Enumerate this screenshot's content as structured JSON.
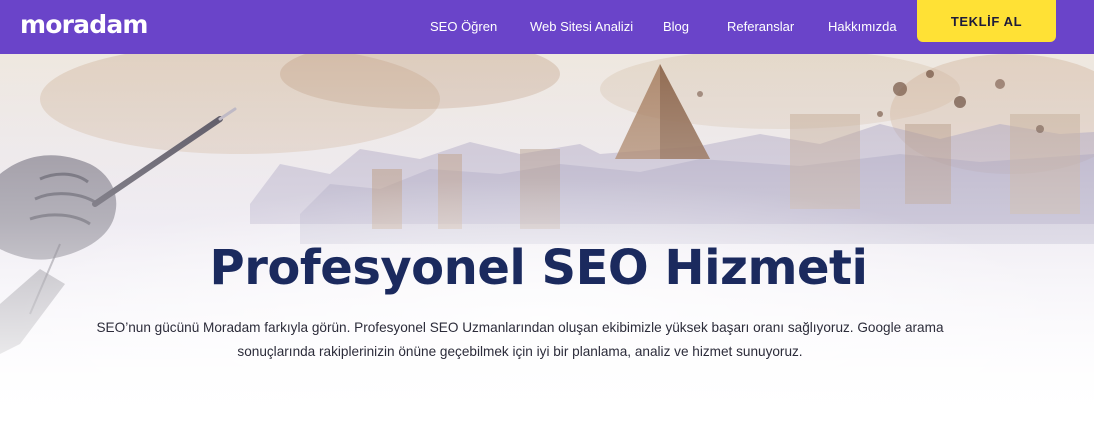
{
  "brand": {
    "logo_text": "moradam"
  },
  "nav": {
    "items": [
      {
        "label": "SEO Öğren"
      },
      {
        "label": "Web Sitesi Analizi"
      },
      {
        "label": "Blog"
      },
      {
        "label": "Referanslar"
      },
      {
        "label": "Hakkımızda"
      }
    ],
    "cta_label": "TEKLİF AL"
  },
  "hero": {
    "title": "Profesyonel SEO Hizmeti",
    "description": "SEO’nun gücünü Moradam farkıyla görün. Profesyonel SEO Uzmanlarından oluşan ekibimizle yüksek başarı oranı sağlıyoruz. Google arama sonuçlarında rakiplerinizin önüne geçebilmek için iyi bir planlama, analiz ve hizmet sunuyoruz."
  },
  "colors": {
    "nav_background": "#6a44c9",
    "cta_background": "#ffe135",
    "title_color": "#1b2a5e"
  }
}
